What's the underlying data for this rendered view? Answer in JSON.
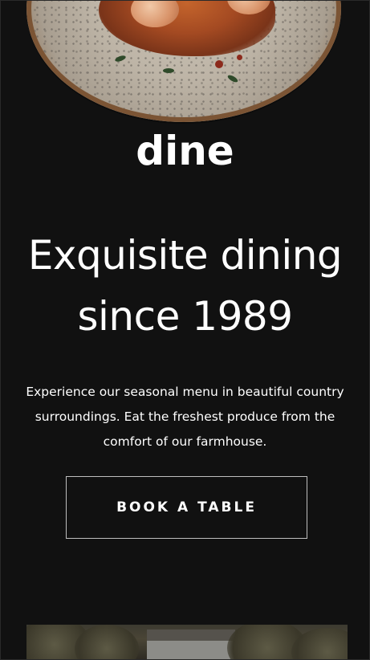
{
  "hero": {
    "image_alt": "plate of shrimp pasta"
  },
  "brand": {
    "logo_text": "dine"
  },
  "headline": {
    "line1": "Exquisite dining",
    "line2": "since 1989"
  },
  "intro": {
    "text": "Experience our seasonal menu in beautiful country surroundings. Eat the freshest produce from the comfort of our farmhouse."
  },
  "cta": {
    "book_label": "BOOK A TABLE"
  },
  "colors": {
    "background": "#111111",
    "text": "#ffffff",
    "button_border": "#bfbfbf"
  }
}
